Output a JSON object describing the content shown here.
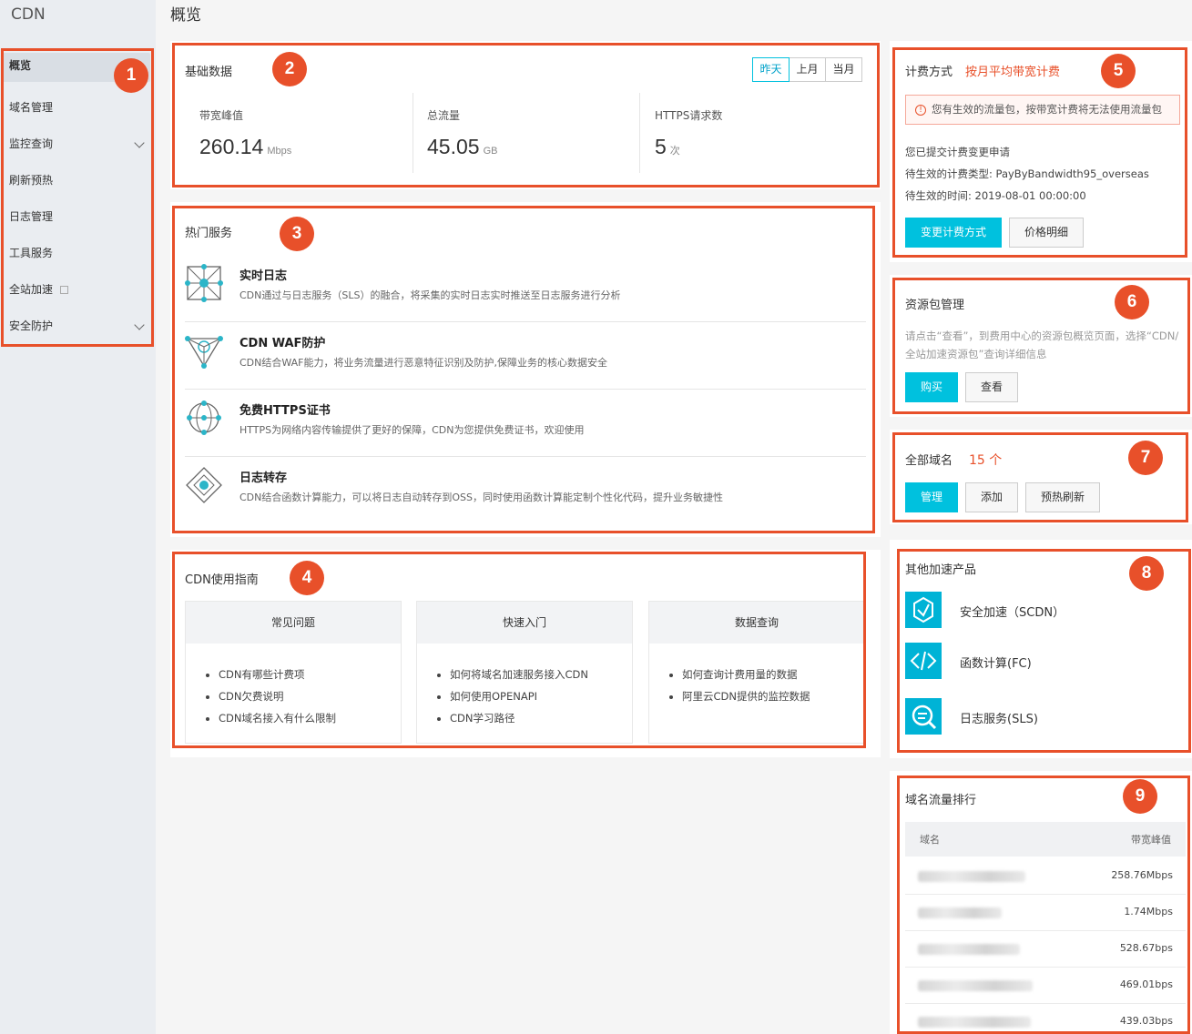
{
  "sidebar": {
    "brand": "CDN",
    "items": [
      {
        "label": "概览"
      },
      {
        "label": "域名管理"
      },
      {
        "label": "监控查询"
      },
      {
        "label": "刷新预热"
      },
      {
        "label": "日志管理"
      },
      {
        "label": "工具服务"
      },
      {
        "label": "全站加速"
      },
      {
        "label": "安全防护"
      }
    ]
  },
  "page_title": "概览",
  "badges": [
    "1",
    "2",
    "3",
    "4",
    "5",
    "6",
    "7",
    "8",
    "9"
  ],
  "basic": {
    "title": "基础数据",
    "tabs": [
      "昨天",
      "上月",
      "当月"
    ],
    "stats": [
      {
        "label": "带宽峰值",
        "value": "260.14",
        "unit": "Mbps"
      },
      {
        "label": "总流量",
        "value": "45.05",
        "unit": "GB"
      },
      {
        "label": "HTTPS请求数",
        "value": "5",
        "unit": "次"
      }
    ]
  },
  "hot": {
    "title": "热门服务",
    "services": [
      {
        "name": "实时日志",
        "desc": "CDN通过与日志服务（SLS）的融合，将采集的实时日志实时推送至日志服务进行分析",
        "icon": "network-node-icon"
      },
      {
        "name": "CDN WAF防护",
        "desc": "CDN结合WAF能力，将业务流量进行恶意特征识别及防护,保障业务的核心数据安全",
        "icon": "waf-shield-icon"
      },
      {
        "name": "免费HTTPS证书",
        "desc": "HTTPS为网络内容传输提供了更好的保障，CDN为您提供免费证书，欢迎使用",
        "icon": "https-globe-icon"
      },
      {
        "name": "日志转存",
        "desc": "CDN结合函数计算能力，可以将日志自动转存到OSS，同时使用函数计算能定制个性化代码，提升业务敏捷性",
        "icon": "log-transfer-icon"
      }
    ]
  },
  "guide": {
    "title": "CDN使用指南",
    "columns": [
      {
        "head": "常见问题",
        "items": [
          "CDN有哪些计费项",
          "CDN欠费说明",
          "CDN域名接入有什么限制"
        ]
      },
      {
        "head": "快速入门",
        "items": [
          "如何将域名加速服务接入CDN",
          "如何使用OPENAPI",
          "CDN学习路径"
        ]
      },
      {
        "head": "数据查询",
        "items": [
          "如何查询计费用量的数据",
          "阿里云CDN提供的监控数据"
        ]
      }
    ]
  },
  "billing": {
    "title": "计费方式",
    "mode": "按月平均带宽计费",
    "alert": "您有生效的流量包，按带宽计费将无法使用流量包",
    "line1": "您已提交计费变更申请",
    "line2": "待生效的计费类型: PayByBandwidth95_overseas",
    "line3": "待生效的时间: 2019-08-01 00:00:00",
    "btn_change": "变更计费方式",
    "btn_price": "价格明细"
  },
  "package": {
    "title": "资源包管理",
    "desc1": "请点击“查看”，到费用中心的资源包概览页面，选择“CDN/",
    "desc2": "全站加速资源包”查询详细信息",
    "btn_buy": "购买",
    "btn_view": "查看"
  },
  "domains": {
    "title": "全部域名",
    "count": "15 个",
    "btn_manage": "管理",
    "btn_add": "添加",
    "btn_refresh": "预热刷新"
  },
  "products": {
    "title": "其他加速产品",
    "items": [
      {
        "label": "安全加速（SCDN）",
        "icon": "scdn-icon"
      },
      {
        "label": "函数计算(FC)",
        "icon": "function-compute-icon"
      },
      {
        "label": "日志服务(SLS)",
        "icon": "log-service-icon"
      }
    ]
  },
  "ranking": {
    "title": "域名流量排行",
    "col_domain": "域名",
    "col_peak": "带宽峰值",
    "rows": [
      {
        "value": "258.76Mbps"
      },
      {
        "value": "1.74Mbps"
      },
      {
        "value": "528.67bps"
      },
      {
        "value": "469.01bps"
      },
      {
        "value": "439.03bps"
      }
    ]
  },
  "colors": {
    "accent": "#00c1de",
    "highlight": "#e8502a"
  }
}
